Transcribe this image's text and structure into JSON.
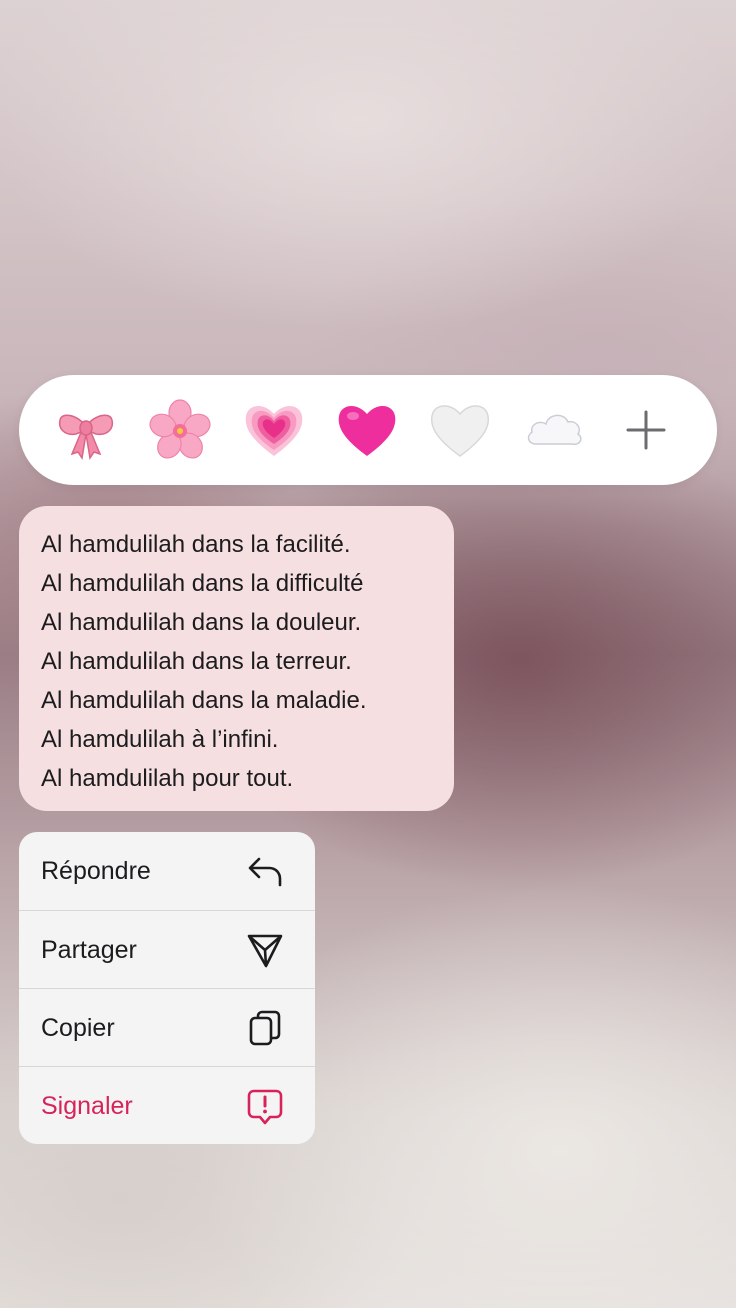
{
  "reactions": [
    {
      "icon": "ribbon-bow-icon",
      "emoji": "🎀"
    },
    {
      "icon": "cherry-blossom-icon",
      "emoji": "🌸"
    },
    {
      "icon": "growing-heart-icon",
      "emoji": "💗"
    },
    {
      "icon": "pink-heart-icon",
      "emoji": "💗"
    },
    {
      "icon": "white-heart-icon",
      "emoji": "🤍"
    },
    {
      "icon": "cloud-icon",
      "emoji": "☁️"
    },
    {
      "icon": "add-reaction-icon",
      "emoji": "+"
    }
  ],
  "message": {
    "lines": [
      "Al hamdulilah dans la facilité.",
      "Al hamdulilah dans la difficulté",
      "Al hamdulilah dans la douleur.",
      "Al hamdulilah dans la terreur.",
      "Al hamdulilah dans la maladie.",
      "Al hamdulilah à l’infini.",
      "Al hamdulilah pour tout."
    ]
  },
  "menu": {
    "reply": {
      "label": "Répondre",
      "icon": "reply-arrow-icon"
    },
    "share": {
      "label": "Partager",
      "icon": "paper-plane-icon"
    },
    "copy": {
      "label": "Copier",
      "icon": "copy-icon"
    },
    "report": {
      "label": "Signaler",
      "icon": "report-icon"
    }
  },
  "colors": {
    "bubble": "#f6dfe1",
    "danger": "#d6245a",
    "menu_bg": "#f5f4f4"
  }
}
